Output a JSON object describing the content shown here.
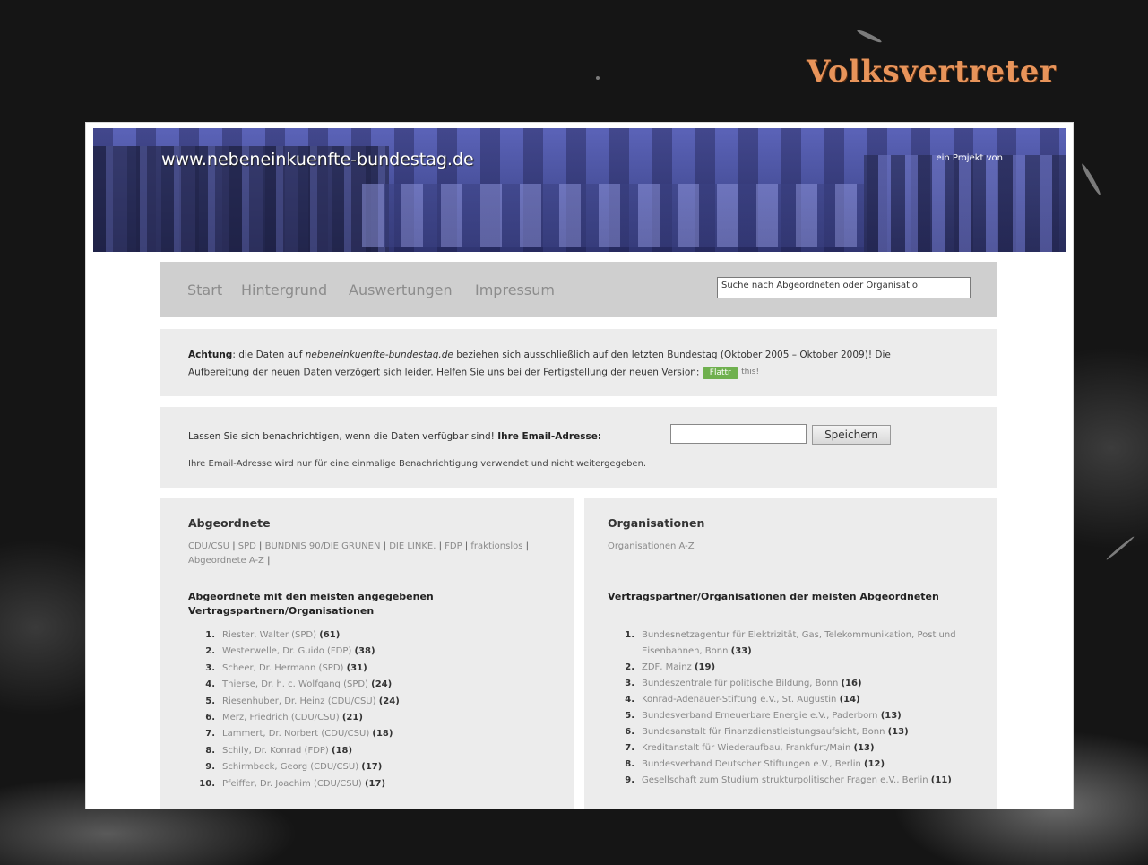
{
  "slide": {
    "title": "Volksvertreter"
  },
  "banner": {
    "url": "www.nebeneinkuenfte-bundestag.de",
    "project": "ein Projekt von"
  },
  "nav": {
    "items": [
      "Start",
      "Hintergrund",
      "Auswertungen",
      "Impressum"
    ],
    "search_placeholder": "Suche nach Abgeordneten oder Organisatio"
  },
  "notice": {
    "label": "Achtung",
    "text1": ": die Daten auf ",
    "site": "nebeneinkuenfte-bundestag.de",
    "text2": " beziehen sich ausschließlich auf den letzten Bundestag (Oktober 2005 – Oktober 2009)! Die Aufbereitung der neuen Daten verzögert sich leider. Helfen Sie uns bei der Fertigstellung der neuen Version: ",
    "donate": "Flattr",
    "donate_tag": "this!"
  },
  "notify": {
    "text": "Lassen Sie sich benachrichtigen, wenn die Daten verfügbar sind! ",
    "email_label": "Ihre Email-Adresse:",
    "save": "Speichern",
    "note": "Ihre Email-Adresse wird nur für eine einmalige Benachrichtigung verwendet und nicht weitergegeben."
  },
  "left": {
    "heading": "Abgeordnete",
    "links": [
      "CDU/CSU",
      "SPD",
      "BÜNDNIS 90/DIE GRÜNEN",
      "DIE LINKE.",
      "FDP",
      "fraktionslos",
      "Abgeordnete A-Z"
    ],
    "subheading": "Abgeordnete mit den meisten angegebenen Vertragspartnern/Organisationen",
    "list": [
      {
        "num": "1.",
        "name": "Riester, Walter (SPD)",
        "count": "(61)"
      },
      {
        "num": "2.",
        "name": "Westerwelle, Dr. Guido (FDP)",
        "count": "(38)"
      },
      {
        "num": "3.",
        "name": "Scheer, Dr. Hermann (SPD)",
        "count": "(31)"
      },
      {
        "num": "4.",
        "name": "Thierse, Dr. h. c. Wolfgang (SPD)",
        "count": "(24)"
      },
      {
        "num": "5.",
        "name": "Riesenhuber, Dr. Heinz (CDU/CSU)",
        "count": "(24)"
      },
      {
        "num": "6.",
        "name": "Merz, Friedrich (CDU/CSU)",
        "count": "(21)"
      },
      {
        "num": "7.",
        "name": "Lammert, Dr. Norbert (CDU/CSU)",
        "count": "(18)"
      },
      {
        "num": "8.",
        "name": "Schily, Dr. Konrad (FDP)",
        "count": "(18)"
      },
      {
        "num": "9.",
        "name": "Schirmbeck, Georg (CDU/CSU)",
        "count": "(17)"
      },
      {
        "num": "10.",
        "name": "Pfeiffer, Dr. Joachim (CDU/CSU)",
        "count": "(17)"
      }
    ]
  },
  "right": {
    "heading": "Organisationen",
    "links": [
      "Organisationen A-Z"
    ],
    "subheading": "Vertragspartner/Organisationen der meisten Abgeordneten",
    "list": [
      {
        "num": "1.",
        "name": "Bundesnetzagentur für Elektrizität, Gas, Telekommunikation, Post und Eisenbahnen, Bonn",
        "count": "(33)"
      },
      {
        "num": "2.",
        "name": "ZDF, Mainz",
        "count": "(19)"
      },
      {
        "num": "3.",
        "name": "Bundeszentrale für politische Bildung, Bonn",
        "count": "(16)"
      },
      {
        "num": "4.",
        "name": "Konrad-Adenauer-Stiftung e.V., St. Augustin",
        "count": "(14)"
      },
      {
        "num": "5.",
        "name": "Bundesverband Erneuerbare Energie e.V., Paderborn",
        "count": "(13)"
      },
      {
        "num": "6.",
        "name": "Bundesanstalt für Finanzdienstleistungsaufsicht, Bonn",
        "count": "(13)"
      },
      {
        "num": "7.",
        "name": "Kreditanstalt für Wiederaufbau, Frankfurt/Main",
        "count": "(13)"
      },
      {
        "num": "8.",
        "name": "Bundesverband Deutscher Stiftungen e.V., Berlin",
        "count": "(12)"
      },
      {
        "num": "9.",
        "name": "Gesellschaft zum Studium strukturpolitischer Fragen e.V., Berlin",
        "count": "(11)"
      }
    ]
  }
}
